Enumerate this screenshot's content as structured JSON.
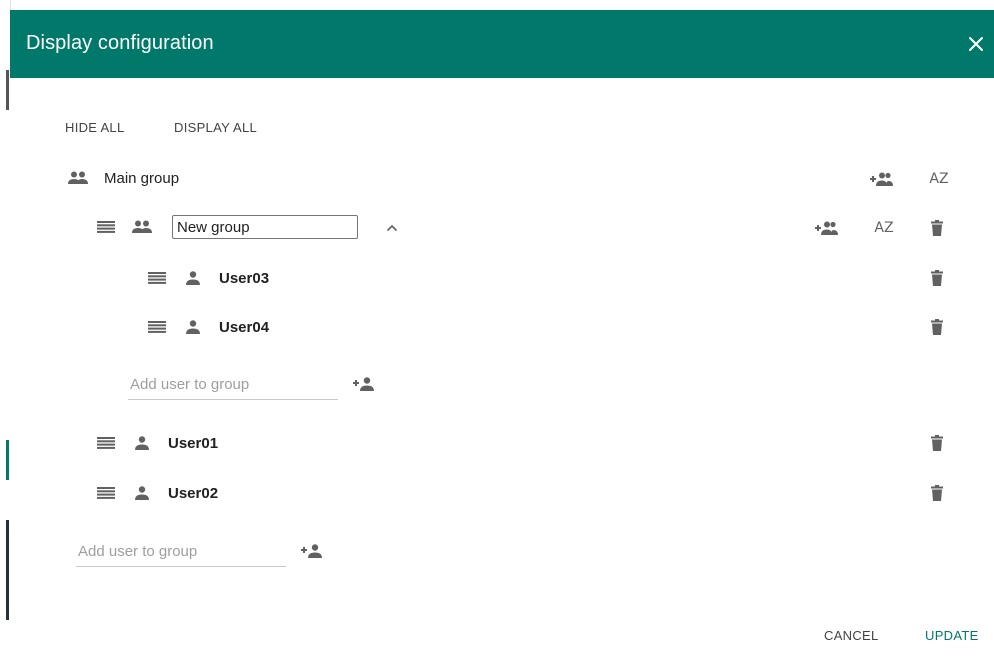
{
  "dialog": {
    "title": "Display configuration",
    "colors": {
      "header": "#00796b",
      "accent": "#00796b",
      "icon": "#616161"
    }
  },
  "toolbar": {
    "hide_all": "HIDE ALL",
    "display_all": "DISPLAY ALL"
  },
  "main_group": {
    "label": "Main group"
  },
  "sort_label": "AZ",
  "new_group": {
    "name_value": "New group",
    "users": [
      {
        "name": "User03"
      },
      {
        "name": "User04"
      }
    ],
    "add_user_placeholder": "Add user to group"
  },
  "root_users": [
    {
      "name": "User01"
    },
    {
      "name": "User02"
    }
  ],
  "root_add_user_placeholder": "Add user to group",
  "footer": {
    "cancel": "CANCEL",
    "update": "UPDATE"
  }
}
